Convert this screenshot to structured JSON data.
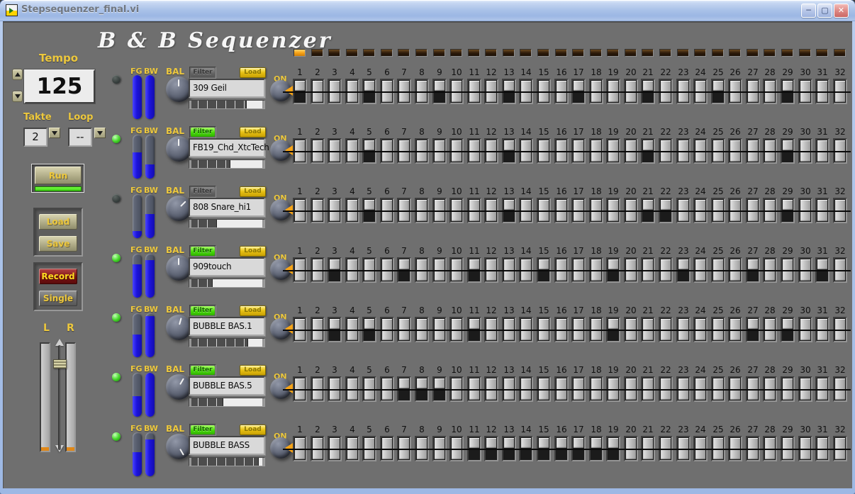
{
  "window_title": "Stepsequenzer_final.vi",
  "icons": {
    "minimize": "─",
    "maximize": "▢",
    "close": "✕"
  },
  "header_title": "B & B Sequenzer",
  "tempo": {
    "label": "Tempo",
    "value": "125"
  },
  "takte": {
    "label": "Takte",
    "value": "2"
  },
  "loop": {
    "label": "Loop",
    "value": "--"
  },
  "buttons": {
    "run": "Run",
    "load": "Load",
    "save": "Save",
    "record": "Record",
    "single": "Single"
  },
  "balance": {
    "left": "L",
    "right": "R",
    "position": 0.15
  },
  "channel_labels": {
    "fg": "FG",
    "bw": "BW",
    "bal": "BAL",
    "on": "ON",
    "filter": "Filter",
    "load": "Load"
  },
  "playhead": {
    "active_step": 1
  },
  "step_numbers": [
    1,
    2,
    3,
    4,
    5,
    6,
    7,
    8,
    9,
    10,
    11,
    12,
    13,
    14,
    15,
    16,
    17,
    18,
    19,
    20,
    21,
    22,
    23,
    24,
    25,
    26,
    27,
    28,
    29,
    30,
    31,
    32
  ],
  "channels": [
    {
      "sample": "309 Geil",
      "led_on": false,
      "fg_level": 1.0,
      "bw_level": 1.0,
      "bal_angle": 0,
      "filter_on": false,
      "pitch": 0.78,
      "active_steps": [
        1,
        5,
        9,
        13,
        17,
        21,
        25,
        29
      ]
    },
    {
      "sample": "FB19_Chd_XtcTech",
      "led_on": true,
      "fg_level": 0.6,
      "bw_level": 0.32,
      "bal_angle": 0,
      "filter_on": true,
      "pitch": 0.55,
      "active_steps": [
        5,
        13,
        21,
        29
      ]
    },
    {
      "sample": "808 Snare_hi1",
      "led_on": false,
      "fg_level": 0.16,
      "bw_level": 0.55,
      "bal_angle": 45,
      "filter_on": false,
      "pitch": 0.36,
      "active_steps": [
        5,
        13,
        21,
        22,
        29
      ]
    },
    {
      "sample": "909touch",
      "led_on": true,
      "fg_level": 0.76,
      "bw_level": 0.86,
      "bal_angle": 0,
      "filter_on": true,
      "pitch": 0.3,
      "active_steps": [
        3,
        7,
        11,
        15,
        19,
        23,
        27,
        31
      ]
    },
    {
      "sample": "BUBBLE BAS.1",
      "led_on": true,
      "fg_level": 0.52,
      "bw_level": 0.94,
      "bal_angle": 15,
      "filter_on": true,
      "pitch": 0.8,
      "active_steps": [
        3,
        5,
        11,
        19,
        27,
        29
      ]
    },
    {
      "sample": "BUBBLE BAS.5",
      "led_on": true,
      "fg_level": 0.46,
      "bw_level": 1.0,
      "bal_angle": 30,
      "filter_on": true,
      "pitch": 0.45,
      "active_steps": [
        7,
        8,
        9
      ]
    },
    {
      "sample": "BUBBLE BASS",
      "led_on": true,
      "fg_level": 0.55,
      "bw_level": 0.84,
      "bal_angle": 150,
      "filter_on": true,
      "pitch": 0.95,
      "active_steps": [
        11,
        12,
        13,
        14,
        15,
        16,
        17,
        18,
        19
      ]
    }
  ],
  "colors": {
    "panel": "#6f6f6f",
    "label_yellow": "#edc83d",
    "slider_blue": "#1c14dd",
    "filter_green": "#46da08",
    "load_yellow": "#e7c013",
    "record_red": "#7c1212",
    "run_green": "#3fd214",
    "playhead_orange": "#f7a418",
    "led_green": "#48d92c"
  }
}
